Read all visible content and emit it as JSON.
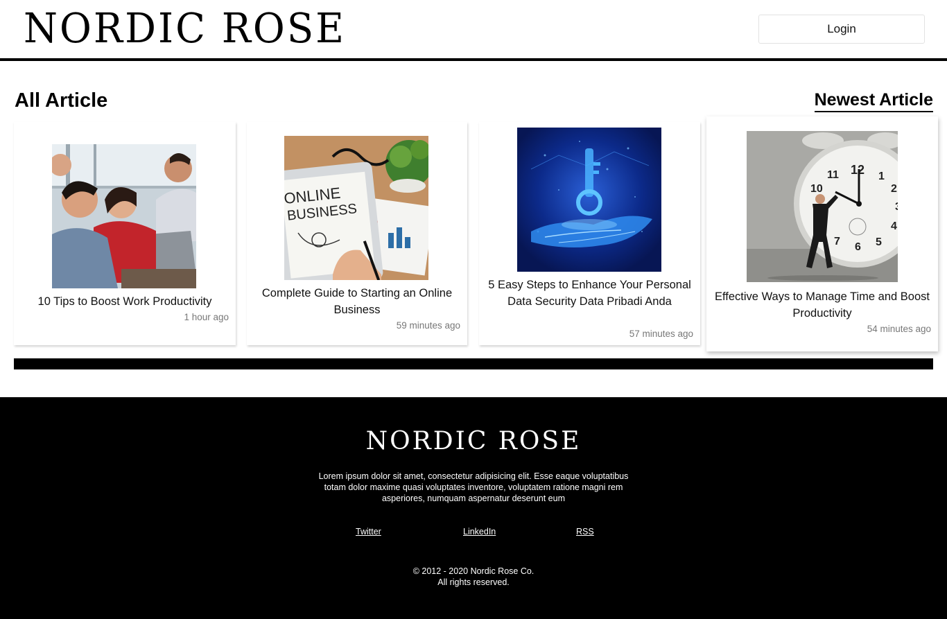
{
  "header": {
    "logo_text": "NORDIC ROSE",
    "login_label": "Login"
  },
  "main": {
    "section_title": "All Article",
    "newest_label": "Newest Article",
    "articles": [
      {
        "title": "10 Tips to Boost Work Productivity",
        "time": "1 hour ago",
        "image": "team-photo"
      },
      {
        "title": "Complete Guide to Starting an Online Business",
        "time": "59 minutes ago",
        "image": "online-business-tablet",
        "image_text": [
          "ONLINE",
          "BUSINESS"
        ]
      },
      {
        "title": "5 Easy Steps to Enhance Your Personal Data Security Data Pribadi Anda",
        "time": "57 minutes ago",
        "image": "digital-key-hand"
      },
      {
        "title": "Effective Ways to Manage Time and Boost Productivity",
        "time": "54 minutes ago",
        "image": "man-pushing-clock",
        "image_clock_numbers": [
          "12",
          "1",
          "2",
          "3",
          "4",
          "5",
          "6",
          "7",
          "10",
          "11"
        ]
      }
    ]
  },
  "footer": {
    "logo_text": "NORDIC ROSE",
    "description": "Lorem ipsum dolor sit amet, consectetur adipisicing elit. Esse eaque voluptatibus totam dolor maxime quasi voluptates inventore, voluptatem ratione magni rem asperiores, numquam aspernatur deserunt eum",
    "links": [
      "Twitter",
      "LinkedIn",
      "RSS"
    ],
    "copyright_line1": "© 2012 - 2020 Nordic Rose Co.",
    "copyright_line2": "All rights reserved."
  },
  "colors": {
    "background": "#ffffff",
    "foreground": "#000000",
    "muted": "#777777"
  }
}
